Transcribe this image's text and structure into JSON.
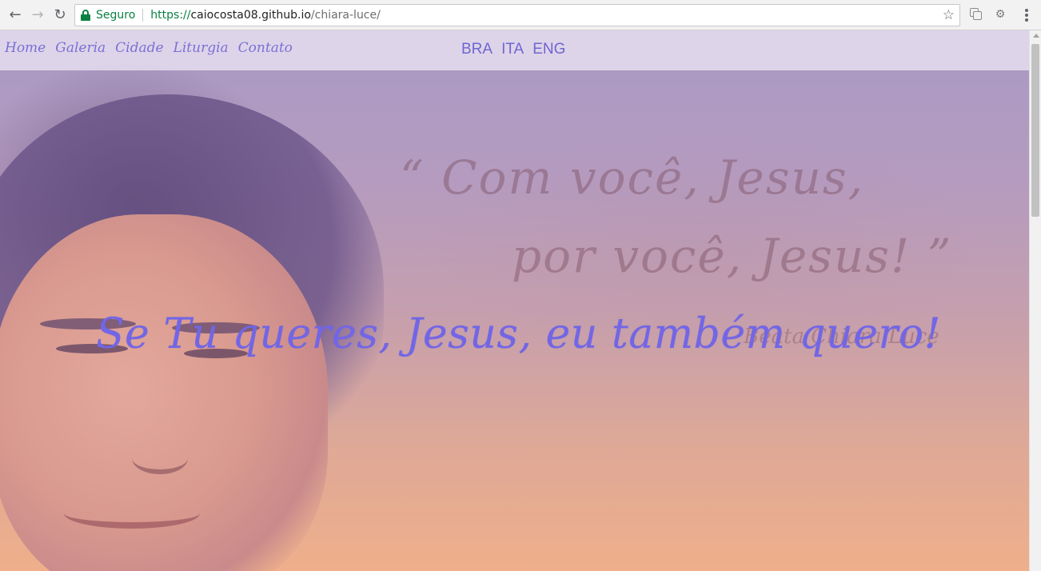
{
  "browser": {
    "secure_label": "Seguro",
    "url_scheme": "https://",
    "url_host": "caiocosta08.github.io",
    "url_path": "/chiara-luce/"
  },
  "nav": {
    "items": [
      "Home",
      "Galeria",
      "Cidade",
      "Liturgia",
      "Contato"
    ]
  },
  "languages": [
    "BRA",
    "ITA",
    "ENG"
  ],
  "hero": {
    "headline": "Se Tu queres, Jesus, eu também quero!",
    "bg_quote_line1": "“ Com você, Jesus,",
    "bg_quote_line2": "por você, Jesus! ”",
    "bg_signature": "Beata Chiara Luce"
  },
  "colors": {
    "accent": "#7266e6",
    "secure_green": "#0b8043"
  }
}
